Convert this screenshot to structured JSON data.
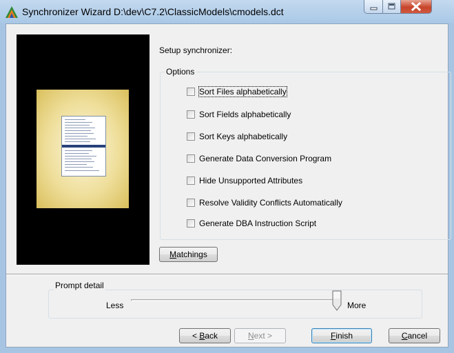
{
  "window": {
    "title": "Synchronizer Wizard D:\\dev\\C7.2\\ClassicModels\\cmodels.dct",
    "minimize_icon": "minimize-icon",
    "maximize_icon": "maximize-icon",
    "close_icon": "close-icon"
  },
  "setup_label": "Setup synchronizer:",
  "options": {
    "group_title": "Options",
    "items": [
      {
        "label": "Sort Files alphabetically",
        "checked": false
      },
      {
        "label": "Sort Fields alphabetically",
        "checked": false
      },
      {
        "label": "Sort Keys alphabetically",
        "checked": false
      },
      {
        "label": "Generate Data Conversion Program",
        "checked": false
      },
      {
        "label": "Hide Unsupported Attributes",
        "checked": false
      },
      {
        "label": "Resolve Validity Conflicts Automatically",
        "checked": false
      },
      {
        "label": "Generate DBA Instruction Script",
        "checked": false
      }
    ]
  },
  "matchings_button": {
    "prefix": "M",
    "rest": "atchings"
  },
  "prompt_detail": {
    "group_title": "Prompt detail",
    "less": "Less",
    "more": "More",
    "level": 1.0
  },
  "footer": {
    "back": {
      "prefix": "< ",
      "accel": "B",
      "rest": "ack"
    },
    "next": {
      "prefix": "",
      "accel": "N",
      "rest": "ext >"
    },
    "finish": {
      "accel": "F",
      "rest": "inish"
    },
    "cancel": {
      "accel": "C",
      "rest": "ancel"
    }
  },
  "colors": {
    "accent_default_button": "#3c7fb1",
    "close_button": "#c7442b",
    "title_bar": "#a9c8e6"
  }
}
